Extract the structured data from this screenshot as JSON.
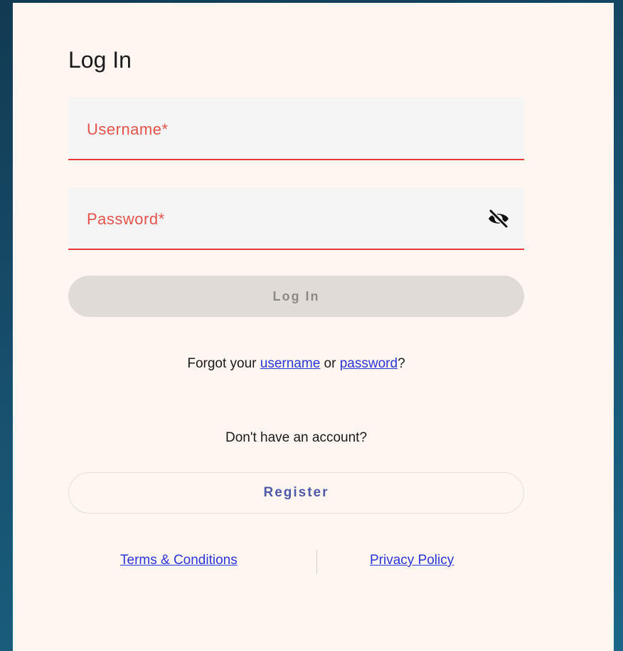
{
  "login": {
    "title": "Log In",
    "username_label": "Username*",
    "password_label": "Password*",
    "login_button": "Log In",
    "forgot_prefix": "Forgot your ",
    "forgot_username": "username",
    "forgot_or": " or ",
    "forgot_password": "password",
    "forgot_suffix": "?",
    "no_account": "Don't have an account?",
    "register_button": "Register",
    "terms_link": "Terms & Conditions",
    "privacy_link": "Privacy Policy"
  },
  "icons": {
    "password_toggle": "eye-slash-icon"
  },
  "colors": {
    "error_red": "#e5534b",
    "card_bg": "#fff6f1",
    "disabled_button_bg": "#e0dbd7",
    "register_text": "#4e5aa8",
    "link_blue": "#2a35d6"
  }
}
